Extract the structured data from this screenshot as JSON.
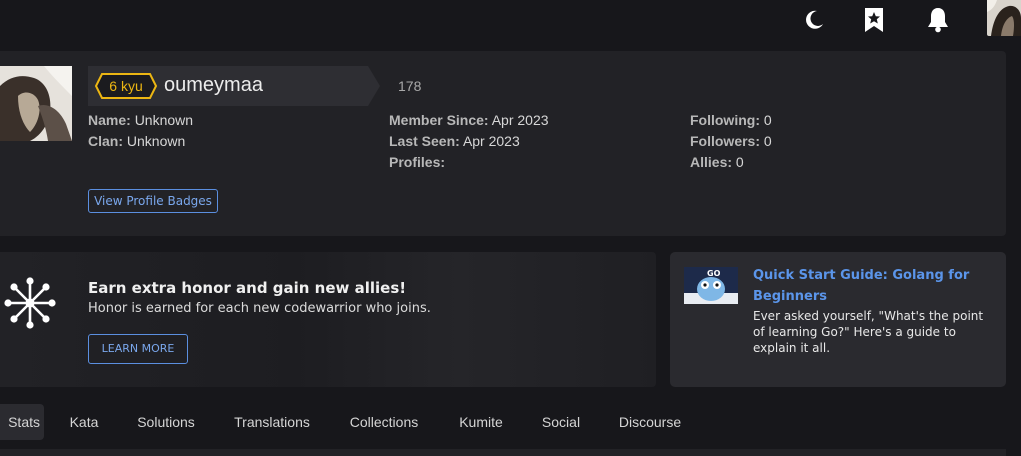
{
  "topbar": {
    "icons": [
      "moon-icon",
      "bookmark-star-icon",
      "bell-icon"
    ],
    "avatar": "user-avatar"
  },
  "profile": {
    "rank": "6 kyu",
    "username": "oumeymaa",
    "honor": "178",
    "name_label": "Name:",
    "name_value": "Unknown",
    "clan_label": "Clan:",
    "clan_value": "Unknown",
    "member_since_label": "Member Since:",
    "member_since_value": "Apr 2023",
    "last_seen_label": "Last Seen:",
    "last_seen_value": "Apr 2023",
    "profiles_label": "Profiles:",
    "following_label": "Following:",
    "following_value": "0",
    "followers_label": "Followers:",
    "followers_value": "0",
    "allies_label": "Allies:",
    "allies_value": "0",
    "badges_button": "View Profile Badges",
    "colors": {
      "rank": "#ecb613",
      "accent": "#5b8fe0"
    }
  },
  "promo": {
    "icon": "network-nodes-icon",
    "title": "Earn extra honor and gain new allies!",
    "subtitle": "Honor is earned for each new codewarrior who joins.",
    "button": "LEARN MORE"
  },
  "guide": {
    "thumbnail": "golang-gopher-thumbnail",
    "title": "Quick Start Guide: Golang for Beginners",
    "description": "Ever asked yourself, \"What's the point of learning Go?\" Here's a guide to explain it all.",
    "thumb_text": "GO"
  },
  "tabs": [
    {
      "label": "Stats",
      "active": true
    },
    {
      "label": "Kata",
      "active": false
    },
    {
      "label": "Solutions",
      "active": false
    },
    {
      "label": "Translations",
      "active": false
    },
    {
      "label": "Collections",
      "active": false
    },
    {
      "label": "Kumite",
      "active": false
    },
    {
      "label": "Social",
      "active": false
    },
    {
      "label": "Discourse",
      "active": false
    }
  ]
}
